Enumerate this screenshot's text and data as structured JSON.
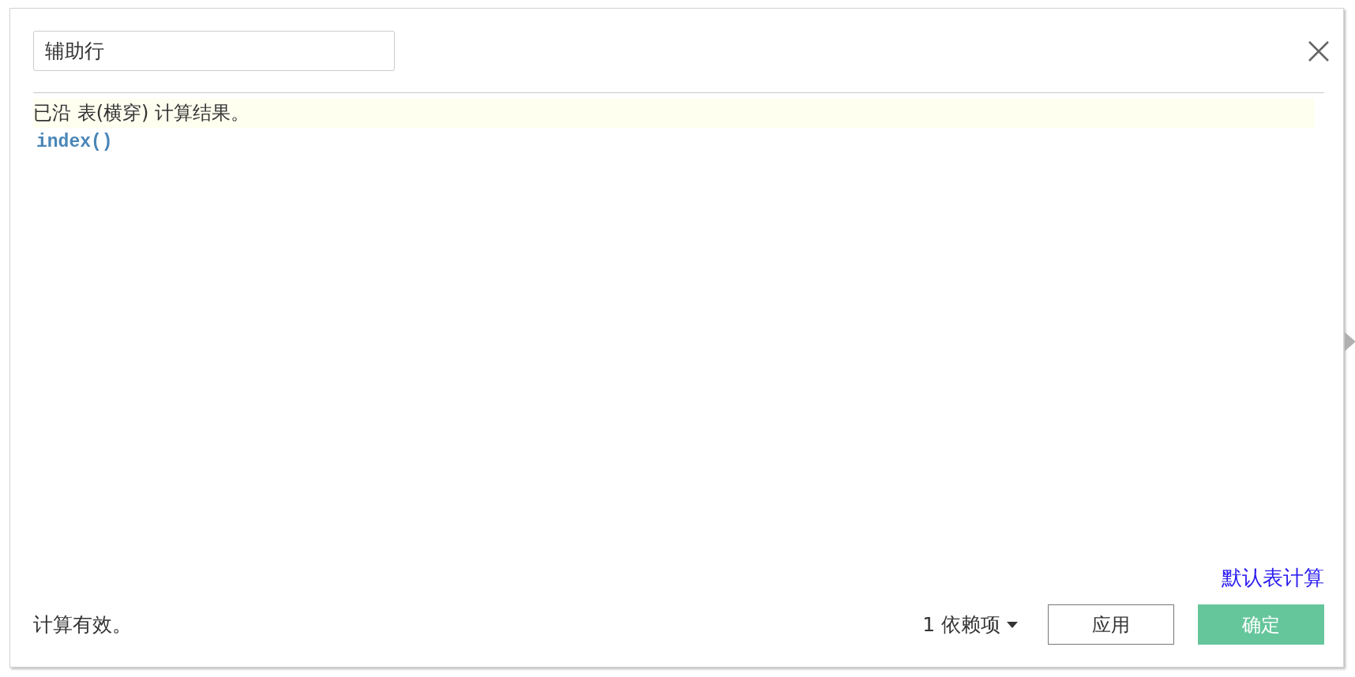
{
  "name_field": {
    "value": "辅助行"
  },
  "notice": "已沿 表(横穿) 计算结果。",
  "formula": "index()",
  "default_link": "默认表计算",
  "status": "计算有效。",
  "dependents": {
    "label": "1 依赖项"
  },
  "buttons": [
    {
      "label": "应用",
      "kind": "secondary"
    },
    {
      "label": "确定",
      "kind": "primary"
    }
  ]
}
